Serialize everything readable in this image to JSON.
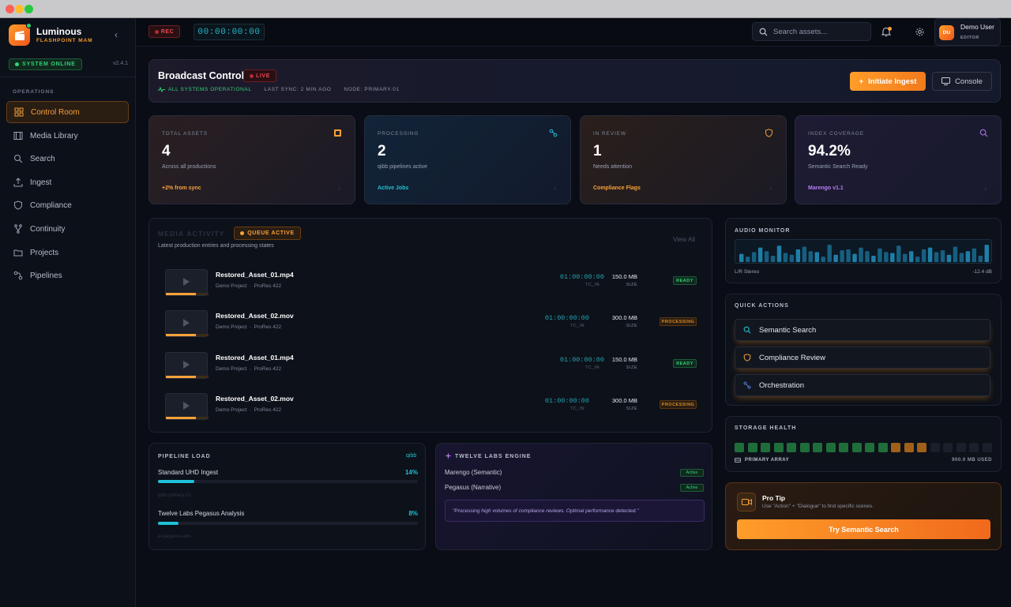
{
  "app": {
    "name": "Luminous",
    "subtitle": "FLASHPOINT MAM",
    "status": "SYSTEM ONLINE",
    "version": "v2.4.1"
  },
  "sidebar": {
    "section": "OPERATIONS",
    "items": [
      {
        "label": "Control Room",
        "icon": "grid-icon",
        "active": true
      },
      {
        "label": "Media Library",
        "icon": "film-icon"
      },
      {
        "label": "Search",
        "icon": "search-icon"
      },
      {
        "label": "Ingest",
        "icon": "upload-icon"
      },
      {
        "label": "Compliance",
        "icon": "shield-icon"
      },
      {
        "label": "Continuity",
        "icon": "branch-icon"
      },
      {
        "label": "Projects",
        "icon": "folder-icon"
      },
      {
        "label": "Pipelines",
        "icon": "pipeline-icon"
      }
    ]
  },
  "topbar": {
    "rec": "REC",
    "timecode": "00:00:00:00",
    "search_placeholder": "Search assets...",
    "user_initials": "DU",
    "user_name": "Demo User",
    "user_role": "EDITOR"
  },
  "header": {
    "title": "Broadcast Control",
    "live": "LIVE",
    "status": "ALL SYSTEMS OPERATIONAL",
    "sync": "LAST SYNC: 2 MIN AGO",
    "node": "NODE: PRIMARY-01",
    "ingest_label": "Initiate Ingest",
    "console_label": "Console"
  },
  "stats": [
    {
      "label": "TOTAL ASSETS",
      "value": "4",
      "sub": "Across all productions",
      "foot": "+2% from sync",
      "color": "#f7a23a"
    },
    {
      "label": "PROCESSING",
      "value": "2",
      "sub": "qibb pipelines active",
      "foot": "Active Jobs",
      "color": "#23c0d2"
    },
    {
      "label": "IN REVIEW",
      "value": "1",
      "sub": "Needs attention",
      "foot": "Compliance Flags",
      "color": "#f7a23a"
    },
    {
      "label": "INDEX COVERAGE",
      "value": "94.2%",
      "sub": "Semantic Search Ready",
      "foot": "Marengo v1.1",
      "color": "#b57cf0"
    }
  ],
  "media": {
    "title": "MEDIA ACTIVITY",
    "badge": "QUEUE ACTIVE",
    "subtitle": "Latest production entries and processing states",
    "view_all": "View All",
    "rows": [
      {
        "name": "Restored_Asset_01.mp4",
        "project": "Demo Project",
        "codec": "ProRes 422",
        "tc": "01:00:00:00",
        "tc_label": "TC_IN",
        "size": "150.0 MB",
        "size_label": "SIZE",
        "status": "READY",
        "progress": 0.7
      },
      {
        "name": "Restored_Asset_02.mov",
        "project": "Demo Project",
        "codec": "ProRes 422",
        "tc": "01:00:00:00",
        "tc_label": "TC_IN",
        "size": "300.0 MB",
        "size_label": "SIZE",
        "status": "PROCESSING",
        "progress": 0.7
      },
      {
        "name": "Restored_Asset_01.mp4",
        "project": "Demo Project",
        "codec": "ProRes 422",
        "tc": "01:00:00:00",
        "tc_label": "TC_IN",
        "size": "150.0 MB",
        "size_label": "SIZE",
        "status": "READY",
        "progress": 0.7
      },
      {
        "name": "Restored_Asset_02.mov",
        "project": "Demo Project",
        "codec": "ProRes 422",
        "tc": "01:00:00:00",
        "tc_label": "TC_IN",
        "size": "300.0 MB",
        "size_label": "SIZE",
        "status": "PROCESSING",
        "progress": 0.7
      }
    ]
  },
  "pipeline": {
    "title": "PIPELINE LOAD",
    "tag": "qibb",
    "items": [
      {
        "label": "Standard UHD Ingest",
        "pct": "14%",
        "value": 0.14,
        "sub": "qibb-primary-01"
      },
      {
        "label": "Twelve Labs Pegasus Analysis",
        "pct": "8%",
        "value": 0.08,
        "sub": "ai-pegasus-aws"
      }
    ]
  },
  "engine": {
    "title": "TWELVE LABS ENGINE",
    "items": [
      {
        "label": "Marengo (Semantic)",
        "status": "Active"
      },
      {
        "label": "Pegasus (Narrative)",
        "status": "Active"
      }
    ],
    "quote": "\"Processing high volumes of compliance reviews. Optimal performance detected.\""
  },
  "audio": {
    "title": "AUDIO MONITOR",
    "channel": "L/R Stereo",
    "level": "-12.4 dB",
    "bars": [
      0.45,
      0.3,
      0.55,
      0.8,
      0.6,
      0.35,
      0.9,
      0.5,
      0.4,
      0.7,
      0.85,
      0.6,
      0.55,
      0.3,
      0.95,
      0.4,
      0.65,
      0.7,
      0.45,
      0.8,
      0.6,
      0.35,
      0.75,
      0.55,
      0.5,
      0.9,
      0.45,
      0.6,
      0.3,
      0.7,
      0.8,
      0.55,
      0.65,
      0.4,
      0.85,
      0.5,
      0.6,
      0.75,
      0.35,
      0.95
    ]
  },
  "quick": {
    "title": "QUICK ACTIONS",
    "items": [
      {
        "label": "Semantic Search",
        "icon": "search-icon"
      },
      {
        "label": "Compliance Review",
        "icon": "shield-icon"
      },
      {
        "label": "Orchestration",
        "icon": "pipeline-icon"
      }
    ]
  },
  "storage": {
    "title": "STORAGE HEALTH",
    "array": "PRIMARY ARRAY",
    "used": "900.0 MB USED",
    "cells": [
      "g",
      "g",
      "g",
      "g",
      "g",
      "g",
      "g",
      "g",
      "g",
      "g",
      "g",
      "g",
      "o",
      "o",
      "o",
      "e",
      "e",
      "e",
      "e",
      "e"
    ]
  },
  "tip": {
    "title": "Pro Tip",
    "text": "Use \"Action\" + \"Dialogue\" to find specific scenes.",
    "button": "Try Semantic Search"
  }
}
